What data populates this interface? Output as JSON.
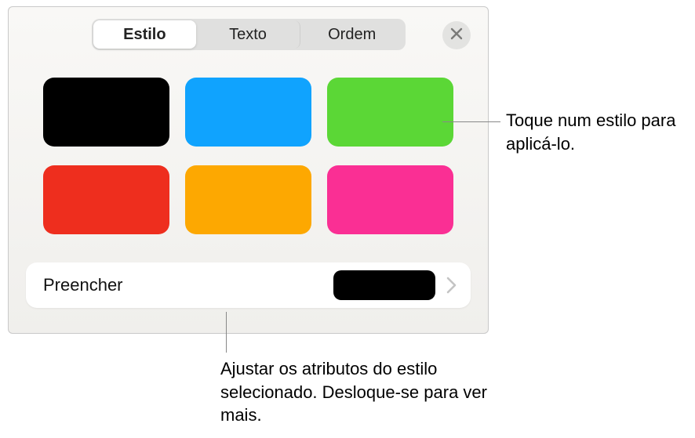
{
  "tabs": {
    "style": "Estilo",
    "text": "Texto",
    "order": "Ordem"
  },
  "swatches": [
    {
      "name": "style-black",
      "color": "#000000"
    },
    {
      "name": "style-blue",
      "color": "#10a3fe"
    },
    {
      "name": "style-green",
      "color": "#5bd736"
    },
    {
      "name": "style-red",
      "color": "#ee2e1e"
    },
    {
      "name": "style-orange",
      "color": "#fda801"
    },
    {
      "name": "style-pink",
      "color": "#fa2f94"
    }
  ],
  "fill": {
    "label": "Preencher",
    "preview_color": "#000000"
  },
  "callouts": {
    "apply_style": "Toque num estilo para aplicá-lo.",
    "adjust_attributes": "Ajustar os atributos do estilo selecionado. Desloque-se para ver mais."
  }
}
